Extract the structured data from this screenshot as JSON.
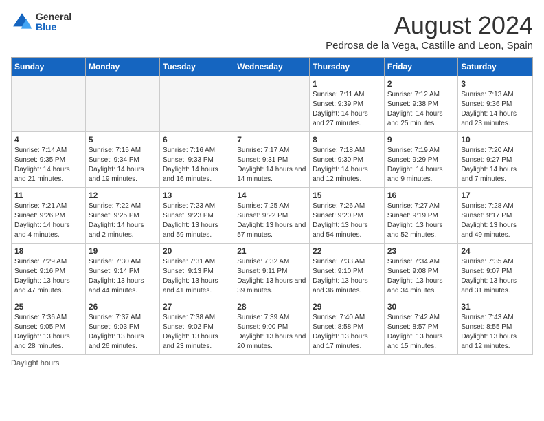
{
  "header": {
    "logo_general": "General",
    "logo_blue": "Blue",
    "month_title": "August 2024",
    "location": "Pedrosa de la Vega, Castille and Leon, Spain"
  },
  "weekdays": [
    "Sunday",
    "Monday",
    "Tuesday",
    "Wednesday",
    "Thursday",
    "Friday",
    "Saturday"
  ],
  "footer": {
    "daylight_label": "Daylight hours"
  },
  "weeks": [
    [
      {
        "day": "",
        "info": ""
      },
      {
        "day": "",
        "info": ""
      },
      {
        "day": "",
        "info": ""
      },
      {
        "day": "",
        "info": ""
      },
      {
        "day": "1",
        "info": "Sunrise: 7:11 AM\nSunset: 9:39 PM\nDaylight: 14 hours and 27 minutes."
      },
      {
        "day": "2",
        "info": "Sunrise: 7:12 AM\nSunset: 9:38 PM\nDaylight: 14 hours and 25 minutes."
      },
      {
        "day": "3",
        "info": "Sunrise: 7:13 AM\nSunset: 9:36 PM\nDaylight: 14 hours and 23 minutes."
      }
    ],
    [
      {
        "day": "4",
        "info": "Sunrise: 7:14 AM\nSunset: 9:35 PM\nDaylight: 14 hours and 21 minutes."
      },
      {
        "day": "5",
        "info": "Sunrise: 7:15 AM\nSunset: 9:34 PM\nDaylight: 14 hours and 19 minutes."
      },
      {
        "day": "6",
        "info": "Sunrise: 7:16 AM\nSunset: 9:33 PM\nDaylight: 14 hours and 16 minutes."
      },
      {
        "day": "7",
        "info": "Sunrise: 7:17 AM\nSunset: 9:31 PM\nDaylight: 14 hours and 14 minutes."
      },
      {
        "day": "8",
        "info": "Sunrise: 7:18 AM\nSunset: 9:30 PM\nDaylight: 14 hours and 12 minutes."
      },
      {
        "day": "9",
        "info": "Sunrise: 7:19 AM\nSunset: 9:29 PM\nDaylight: 14 hours and 9 minutes."
      },
      {
        "day": "10",
        "info": "Sunrise: 7:20 AM\nSunset: 9:27 PM\nDaylight: 14 hours and 7 minutes."
      }
    ],
    [
      {
        "day": "11",
        "info": "Sunrise: 7:21 AM\nSunset: 9:26 PM\nDaylight: 14 hours and 4 minutes."
      },
      {
        "day": "12",
        "info": "Sunrise: 7:22 AM\nSunset: 9:25 PM\nDaylight: 14 hours and 2 minutes."
      },
      {
        "day": "13",
        "info": "Sunrise: 7:23 AM\nSunset: 9:23 PM\nDaylight: 13 hours and 59 minutes."
      },
      {
        "day": "14",
        "info": "Sunrise: 7:25 AM\nSunset: 9:22 PM\nDaylight: 13 hours and 57 minutes."
      },
      {
        "day": "15",
        "info": "Sunrise: 7:26 AM\nSunset: 9:20 PM\nDaylight: 13 hours and 54 minutes."
      },
      {
        "day": "16",
        "info": "Sunrise: 7:27 AM\nSunset: 9:19 PM\nDaylight: 13 hours and 52 minutes."
      },
      {
        "day": "17",
        "info": "Sunrise: 7:28 AM\nSunset: 9:17 PM\nDaylight: 13 hours and 49 minutes."
      }
    ],
    [
      {
        "day": "18",
        "info": "Sunrise: 7:29 AM\nSunset: 9:16 PM\nDaylight: 13 hours and 47 minutes."
      },
      {
        "day": "19",
        "info": "Sunrise: 7:30 AM\nSunset: 9:14 PM\nDaylight: 13 hours and 44 minutes."
      },
      {
        "day": "20",
        "info": "Sunrise: 7:31 AM\nSunset: 9:13 PM\nDaylight: 13 hours and 41 minutes."
      },
      {
        "day": "21",
        "info": "Sunrise: 7:32 AM\nSunset: 9:11 PM\nDaylight: 13 hours and 39 minutes."
      },
      {
        "day": "22",
        "info": "Sunrise: 7:33 AM\nSunset: 9:10 PM\nDaylight: 13 hours and 36 minutes."
      },
      {
        "day": "23",
        "info": "Sunrise: 7:34 AM\nSunset: 9:08 PM\nDaylight: 13 hours and 34 minutes."
      },
      {
        "day": "24",
        "info": "Sunrise: 7:35 AM\nSunset: 9:07 PM\nDaylight: 13 hours and 31 minutes."
      }
    ],
    [
      {
        "day": "25",
        "info": "Sunrise: 7:36 AM\nSunset: 9:05 PM\nDaylight: 13 hours and 28 minutes."
      },
      {
        "day": "26",
        "info": "Sunrise: 7:37 AM\nSunset: 9:03 PM\nDaylight: 13 hours and 26 minutes."
      },
      {
        "day": "27",
        "info": "Sunrise: 7:38 AM\nSunset: 9:02 PM\nDaylight: 13 hours and 23 minutes."
      },
      {
        "day": "28",
        "info": "Sunrise: 7:39 AM\nSunset: 9:00 PM\nDaylight: 13 hours and 20 minutes."
      },
      {
        "day": "29",
        "info": "Sunrise: 7:40 AM\nSunset: 8:58 PM\nDaylight: 13 hours and 17 minutes."
      },
      {
        "day": "30",
        "info": "Sunrise: 7:42 AM\nSunset: 8:57 PM\nDaylight: 13 hours and 15 minutes."
      },
      {
        "day": "31",
        "info": "Sunrise: 7:43 AM\nSunset: 8:55 PM\nDaylight: 13 hours and 12 minutes."
      }
    ]
  ]
}
